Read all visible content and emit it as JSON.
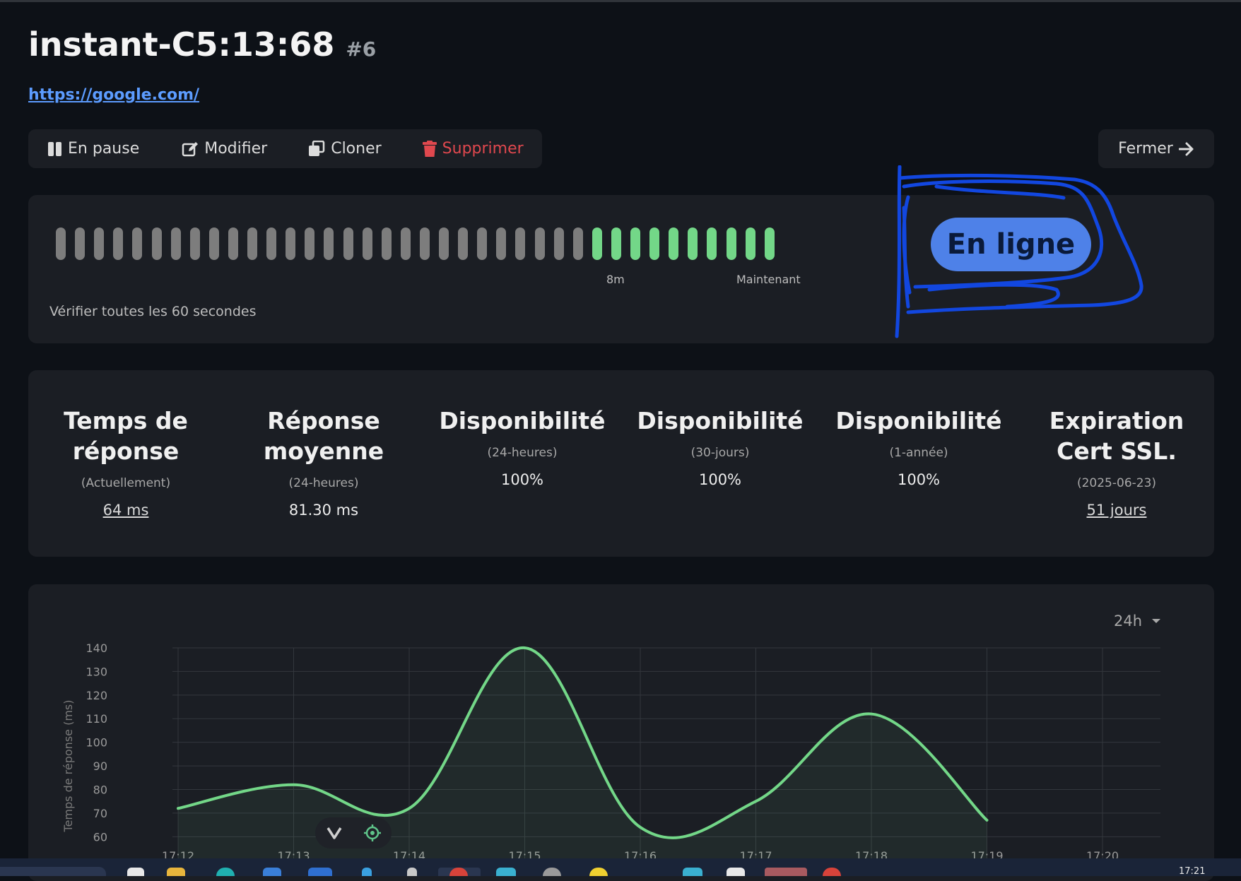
{
  "monitor": {
    "name": "instant-C5:13:68",
    "id": "#6",
    "url": "https://google.com/"
  },
  "toolbar": {
    "pause": "En pause",
    "edit": "Modifier",
    "clone": "Cloner",
    "delete": "Supprimer",
    "close": "Fermer"
  },
  "heartbeat": {
    "beats": [
      "down",
      "down",
      "down",
      "down",
      "down",
      "down",
      "down",
      "down",
      "down",
      "down",
      "down",
      "down",
      "down",
      "down",
      "down",
      "down",
      "down",
      "down",
      "down",
      "down",
      "down",
      "down",
      "down",
      "down",
      "down",
      "down",
      "down",
      "down",
      "up",
      "up",
      "up",
      "up",
      "up",
      "up",
      "up",
      "up",
      "up",
      "up"
    ],
    "label_ago": "8m",
    "label_now": "Maintenant",
    "interval_text": "Vérifier toutes les 60 secondes",
    "status": "En ligne",
    "colors": {
      "up": "#73d788",
      "down": "#7d7d7d",
      "status": "#4e81e8"
    }
  },
  "stats": [
    {
      "title": "Temps de réponse",
      "subtitle": "(Actuellement)",
      "value": "64 ms"
    },
    {
      "title": "Réponse moyenne",
      "subtitle": "(24-heures)",
      "value": "81.30 ms"
    },
    {
      "title": "Disponibilité",
      "subtitle": "(24-heures)",
      "value": "100%"
    },
    {
      "title": "Disponibilité",
      "subtitle": "(30-jours)",
      "value": "100%"
    },
    {
      "title": "Disponibilité",
      "subtitle": "(1-année)",
      "value": "100%"
    },
    {
      "title": "Expiration Cert SSL.",
      "subtitle": "(2025-06-23)",
      "value": "51 jours"
    }
  ],
  "chart_range": "24h",
  "chart_data": {
    "type": "area",
    "ylabel": "Temps de réponse (ms)",
    "xlabel": "",
    "yticks": [
      60,
      70,
      80,
      90,
      100,
      110,
      120,
      130,
      140
    ],
    "xticks": [
      "17:12",
      "17:13",
      "17:14",
      "17:15",
      "17:16",
      "17:17",
      "17:18",
      "17:19",
      "17:20"
    ],
    "ylim": [
      58,
      140
    ],
    "x": [
      "17:12",
      "17:13",
      "17:14",
      "17:15",
      "17:16",
      "17:17",
      "17:18",
      "17:19"
    ],
    "values": [
      72,
      82,
      72,
      140,
      64,
      75,
      112,
      67
    ],
    "grid": true,
    "color": "#73d788"
  },
  "taskbar": {
    "clock": "17:21"
  }
}
